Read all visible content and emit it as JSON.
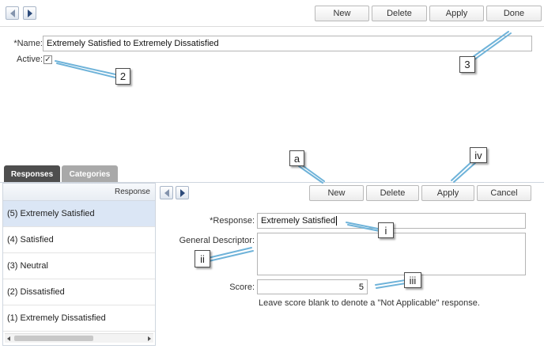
{
  "toolbar": {
    "new_label": "New",
    "delete_label": "Delete",
    "apply_label": "Apply",
    "done_label": "Done"
  },
  "form": {
    "name_label": "*Name:",
    "name_value": "Extremely Satisfied to Extremely Dissatisfied",
    "active_label": "Active:",
    "active_checked": true
  },
  "tabs": [
    {
      "label": "Responses",
      "active": true
    },
    {
      "label": "Categories",
      "active": false
    }
  ],
  "list": {
    "header": "Response",
    "items": [
      "(5) Extremely Satisfied",
      "(4) Satisfied",
      "(3) Neutral",
      "(2) Dissatisfied",
      "(1) Extremely Dissatisfied"
    ],
    "selected_index": 0
  },
  "detail_toolbar": {
    "new_label": "New",
    "delete_label": "Delete",
    "apply_label": "Apply",
    "cancel_label": "Cancel"
  },
  "detail": {
    "response_label": "*Response:",
    "response_value": "Extremely Satisfied",
    "descriptor_label": "General Descriptor:",
    "descriptor_value": "",
    "score_label": "Score:",
    "score_value": "5",
    "hint": "Leave score blank to denote a \"Not Applicable\" response."
  },
  "callouts": {
    "c2": "2",
    "c3": "3",
    "ca": "a",
    "civ": "iv",
    "ci": "i",
    "cii": "ii",
    "ciii": "iii"
  },
  "colors": {
    "tab_active": "#4e4e4e",
    "tab_inactive": "#a9a9a9",
    "callout_line": "#6fb3d9",
    "selected_row": "#dbe6f5"
  }
}
